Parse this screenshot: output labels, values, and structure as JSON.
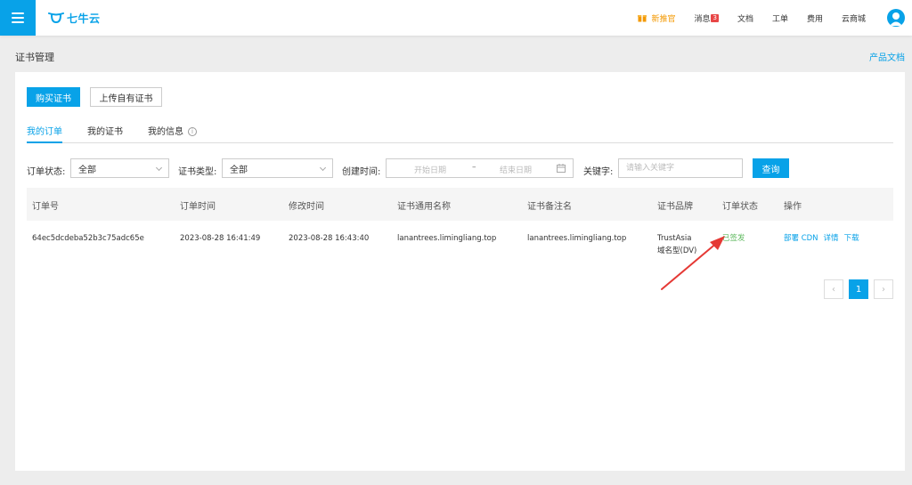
{
  "header": {
    "logo_text": "七牛云",
    "nav": [
      {
        "label": "新推官",
        "icon": "gift-icon",
        "accent": "#f39800"
      },
      {
        "label": "消息",
        "badge": "3"
      },
      {
        "label": "文档"
      },
      {
        "label": "工单"
      },
      {
        "label": "费用"
      },
      {
        "label": "云商城"
      }
    ]
  },
  "page": {
    "title": "证书管理",
    "doc_link": "产品文档"
  },
  "actions": {
    "buy": "购买证书",
    "upload": "上传自有证书"
  },
  "tabs": [
    {
      "label": "我的订单",
      "active": true
    },
    {
      "label": "我的证书",
      "active": false
    },
    {
      "label": "我的信息",
      "active": false,
      "info_icon": "i"
    }
  ],
  "filters": {
    "order_status_label": "订单状态:",
    "order_status_value": "全部",
    "cert_type_label": "证书类型:",
    "cert_type_value": "全部",
    "created_label": "创建时间:",
    "start_placeholder": "开始日期",
    "range_sep": "–",
    "end_placeholder": "结束日期",
    "keyword_label": "关键字:",
    "keyword_placeholder": "请输入关键字",
    "query_button": "查询"
  },
  "table": {
    "columns": [
      "订单号",
      "订单时间",
      "修改时间",
      "证书通用名称",
      "证书备注名",
      "证书品牌",
      "订单状态",
      "操作"
    ],
    "rows": [
      {
        "order_id": "64ec5dcdeba52b3c75adc65e",
        "order_time": "2023-08-28 16:41:49",
        "modified_time": "2023-08-28 16:43:40",
        "common_name": "lanantrees.limingliang.top",
        "remark_name": "lanantrees.limingliang.top",
        "brand_line1": "TrustAsia",
        "brand_line2": "域名型(DV)",
        "status": "已签发",
        "ops": [
          "部署 CDN",
          "详情",
          "下载"
        ]
      }
    ]
  },
  "pagination": {
    "prev": "‹",
    "current": "1",
    "next": "›"
  },
  "colors": {
    "accent": "#08a2e8",
    "success": "#5cb85c",
    "annotation_arrow": "#e53935"
  }
}
